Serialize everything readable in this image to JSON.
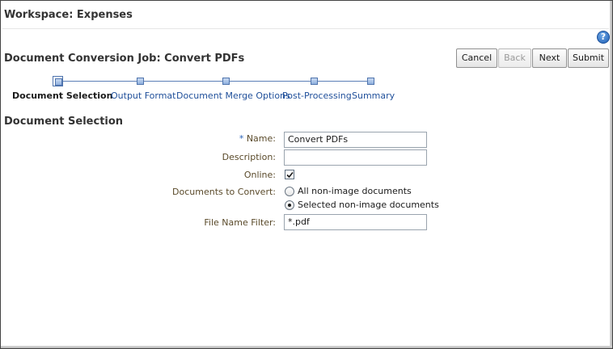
{
  "workspace": {
    "title": "Workspace: Expenses"
  },
  "help": {
    "glyph": "?"
  },
  "job": {
    "title": "Document Conversion Job: Convert PDFs"
  },
  "toolbar": {
    "cancel_label": "Cancel",
    "back_label": "Back",
    "next_label": "Next",
    "submit_label": "Submit"
  },
  "train": {
    "current_step": "Document Selection",
    "steps": [
      {
        "label": "Document Selection"
      },
      {
        "label": "Output Format"
      },
      {
        "label": "Document Merge Options"
      },
      {
        "label": "Post-Processing"
      },
      {
        "label": "Summary"
      }
    ]
  },
  "section": {
    "title": "Document Selection"
  },
  "form": {
    "name": {
      "required_mark": "*",
      "label": "Name:",
      "value": "Convert PDFs"
    },
    "description": {
      "label": "Description:",
      "value": ""
    },
    "online": {
      "label": "Online:",
      "checked": true
    },
    "documents_to_convert": {
      "label": "Documents to Convert:",
      "options": [
        {
          "label": "All non-image documents",
          "selected": false
        },
        {
          "label": "Selected non-image documents",
          "selected": true
        }
      ]
    },
    "file_name_filter": {
      "label": "File Name Filter:",
      "value": "*.pdf"
    }
  },
  "colors": {
    "link": "#1f4f9a",
    "train_line": "#5b7fb7",
    "label": "#5a4a2a",
    "help_icon": "#1f5fb5"
  }
}
